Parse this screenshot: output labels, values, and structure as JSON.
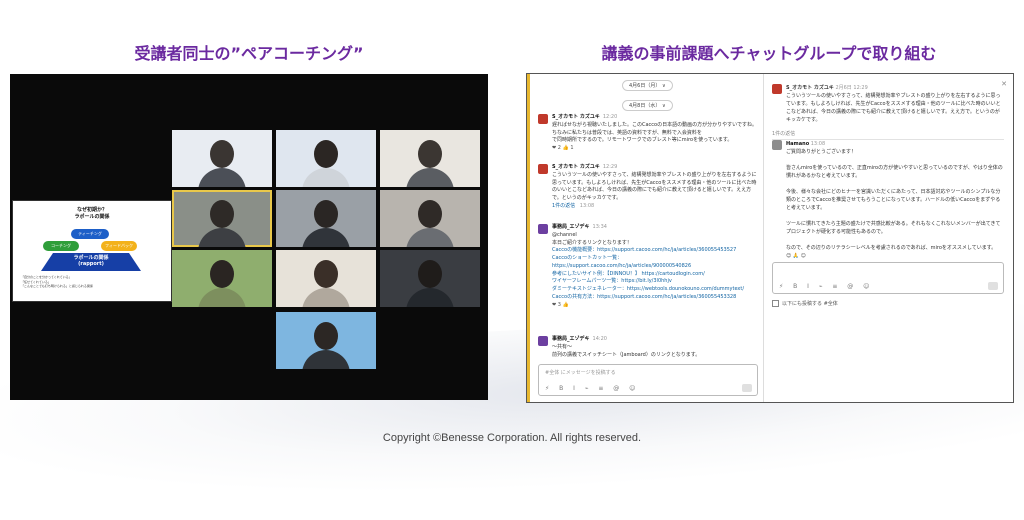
{
  "headings": {
    "left": "受講者同士の”ペアコーチング”",
    "right": "講義の事前課題へチャットグループで取り組む"
  },
  "meeting": {
    "slide": {
      "title": "なぜ初期か？\nラポールの関係",
      "pill_a": "ティーチング",
      "pill_b": "コーチング",
      "pill_c": "フィードバック",
      "pyramid_label": "ラポールの関係\n(rapport)",
      "notes": "「自分のことを分かってくれている」\n「任せてくれている」\n「こんなことでも打ち明けられる」と感じられる関係"
    }
  },
  "chat": {
    "date_1": "4月6日（月） ∨",
    "date_2": "4月8日（水） ∨",
    "messages": [
      {
        "who": "S_オカモト カズユキ",
        "time": "12:20",
        "text": "遅ればせながら視聴いたしました。このCaccoの日本語の動画の方が分かりやすいですね。ちなみに私たちは普段では、英語の資料ですが、無料で入会資料を\nで同時期所でするので。リモートワークでのブレスト等にmiroを使っています。",
        "reactions": "❤ 2  👍 1"
      },
      {
        "who": "S_オカモト カズユキ",
        "time": "12:29",
        "text": "こういうツールの使いやすさって、結構発想効率やブレストの盛り上がりを左右するように思っています。もしよろしければ、先生がCaccoをススメする理由・他のツールに比べた時のいいとこなどあれば、今日の講義の際にでも紹介に教えて頂けると嬉しいです。ええ方で。というのがキッカケです。",
        "reply": "1件の返信",
        "reply_time": "13:08"
      },
      {
        "who": "事務局_エゾデキ",
        "time": "13:34",
        "text": "@channel\n本日ご紹介するリンクとなります！",
        "links": [
          "Caccoの機能概要：https://support.cacoo.com/hc/ja/articles/360055453527",
          "Caccoのショートカット一覧：https://support.cacoo.com/hc/ja/articles/900000540826",
          "参考にしたいサイト例：【DINNOU！】 https://cartoudlogin.com/",
          "ワイヤーフレームパーツ一覧：https://bit.ly/3l0hhjv",
          "ダミーテキストジェネレーター：https://webtools.dounokouno.com/dummytext/",
          "Caccoの共有方法：https://support.cacoo.com/hc/ja/articles/360055453328"
        ],
        "reactions": "❤ 3  👍"
      },
      {
        "who": "事務局_エゾデキ",
        "time": "14:20",
        "text": "〜共有〜\n前列の講義でスイッチシート（Jamboard）のリンクとなります。"
      }
    ],
    "composer_placeholder": "#全体 にメッセージを投稿する",
    "thread": {
      "parent_who": "S_オカモト カズユキ",
      "parent_time": "2月6日 12:29",
      "parent_text": "こういうツールの使いやすさって、結構発想効率やブレストの盛り上がりを左右するように思っています。もしよろしければ、先生がCaccoをススメする理由・他のツールに比べた時のいいとこなどあれば、今日の講義の際にでも紹介に教えて頂けると嬉しいです。ええ方で。というのがキッカケです。",
      "reply_count": "1件の返信",
      "reply_who": "Hamano",
      "reply_time": "13:08",
      "reply_text": "ご質問ありがとうございます！\n\n皆さんmiroを使っているので、正直miroの方が使いやすいと思っているのですが、やはり全体の慣れがあるかなと考えています。\n\n今後、様々な会社にどのヒナーを宮識いただくにあたって、日本語対応やツールのシンプルな分類のところでCaccoを推奨させてもらうことになっています。ハードルの低いCaccoをまずやると考えています。\n\nツールに慣れてきたら主題の盛たけで共感比較がある。それもなくこれないメンバーが出てきてプロジェクトが硬化する可能性もあるので。\n\nなので、その辺りのリテラシーレベルを考慮されるのであれば、miroをオススメしています。",
      "composer_placeholder": "",
      "checkbox_label": "以下にも投稿する  #全体"
    }
  },
  "footer": {
    "copyright": "Copyright ©Benesse Corporation. All rights reserved."
  }
}
